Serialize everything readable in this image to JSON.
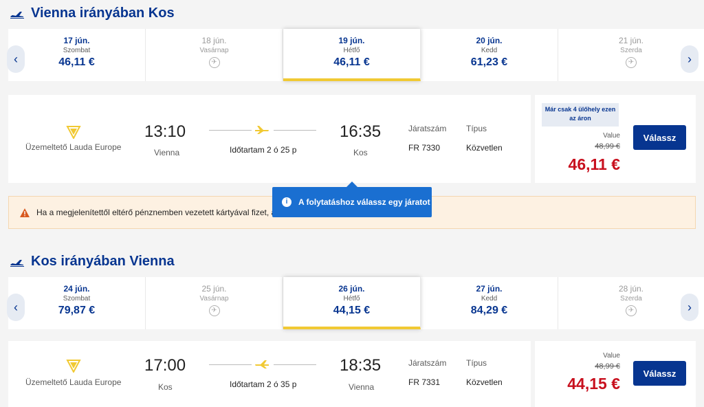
{
  "outbound": {
    "title": "Vienna irányában Kos",
    "dates": [
      {
        "date": "17 jún.",
        "day": "Szombat",
        "price": "46,11 €",
        "available": true
      },
      {
        "date": "18 jún.",
        "day": "Vasárnap",
        "price": "",
        "available": false
      },
      {
        "date": "19 jún.",
        "day": "Hétfő",
        "price": "46,11 €",
        "available": true,
        "selected": true
      },
      {
        "date": "20 jún.",
        "day": "Kedd",
        "price": "61,23 €",
        "available": true
      },
      {
        "date": "21 jún.",
        "day": "Szerda",
        "price": "",
        "available": false
      }
    ],
    "flight": {
      "operator": "Üzemeltető Lauda Europe",
      "depart_time": "13:10",
      "depart_city": "Vienna",
      "arrive_time": "16:35",
      "arrive_city": "Kos",
      "duration": "Időtartam 2 ó 25 p",
      "flight_no_label": "Járatszám",
      "flight_no": "FR 7330",
      "type_label": "Típus",
      "type": "Közvetlen",
      "seats_badge": "Már csak 4 ülőhely ezen az áron",
      "fare_label": "Value",
      "old_price": "48,99 €",
      "price": "46,11 €",
      "select_label": "Válassz"
    }
  },
  "warning": {
    "text": "Ha a megjelenítettől eltérő pénznemben vezetett kártyával fizet, a"
  },
  "tooltip": {
    "text": "A folytatáshoz válassz egy járatot"
  },
  "inbound": {
    "title": "Kos irányában Vienna",
    "dates": [
      {
        "date": "24 jún.",
        "day": "Szombat",
        "price": "79,87 €",
        "available": true
      },
      {
        "date": "25 jún.",
        "day": "Vasárnap",
        "price": "",
        "available": false
      },
      {
        "date": "26 jún.",
        "day": "Hétfő",
        "price": "44,15 €",
        "available": true,
        "selected": true
      },
      {
        "date": "27 jún.",
        "day": "Kedd",
        "price": "84,29 €",
        "available": true
      },
      {
        "date": "28 jún.",
        "day": "Szerda",
        "price": "",
        "available": false
      }
    ],
    "flight": {
      "operator": "Üzemeltető Lauda Europe",
      "depart_time": "17:00",
      "depart_city": "Kos",
      "arrive_time": "18:35",
      "arrive_city": "Vienna",
      "duration": "Időtartam 2 ó 35 p",
      "flight_no_label": "Járatszám",
      "flight_no": "FR 7331",
      "type_label": "Típus",
      "type": "Közvetlen",
      "fare_label": "Value",
      "old_price": "48,99 €",
      "price": "44,15 €",
      "select_label": "Válassz"
    }
  },
  "colors": {
    "brand_blue": "#073590",
    "price_red": "#c8101e",
    "accent_yellow": "#f1c933",
    "tooltip_blue": "#1a6fd1"
  }
}
